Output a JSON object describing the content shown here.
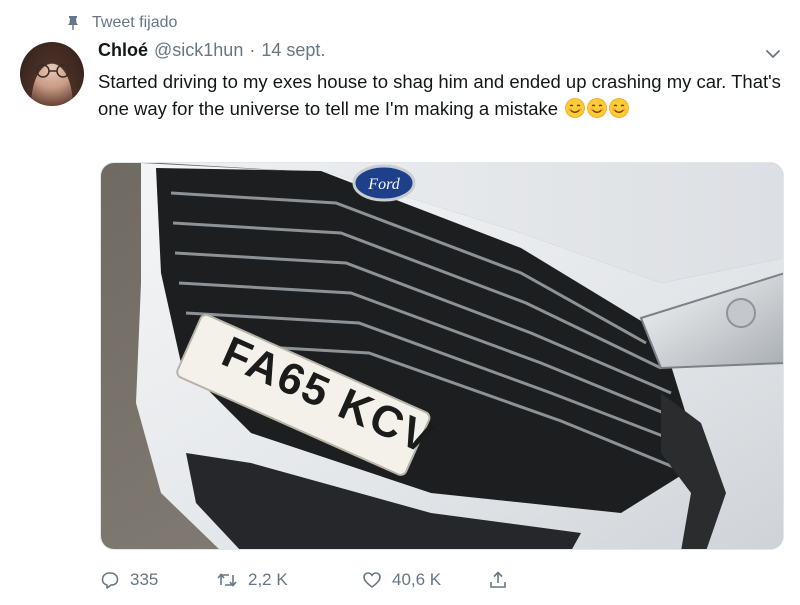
{
  "pinned": {
    "label": "Tweet fijado"
  },
  "author": {
    "name": "Chloé",
    "handle": "@sick1hun",
    "separator": "·",
    "date": "14 sept."
  },
  "tweet": {
    "text": "Started driving to my exes house to shag him and ended up crashing my car. That's one way for the universe to tell me I'm making a mistake",
    "emoji": [
      "smiling-face-with-smiling-eyes",
      "smiling-face-with-smiling-eyes",
      "smiling-face-with-smiling-eyes"
    ]
  },
  "media": {
    "plate_text": "FA65 KCV",
    "badge_text": "Ford"
  },
  "actions": {
    "replies": "335",
    "retweets": "2,2 K",
    "likes": "40,6 K"
  },
  "colors": {
    "secondary_text": "#657786",
    "primary_text": "#14171a",
    "border": "#e1e8ed"
  },
  "icons": [
    "pin-icon",
    "chevron-down-icon",
    "reply-icon",
    "retweet-icon",
    "like-icon",
    "share-icon"
  ]
}
